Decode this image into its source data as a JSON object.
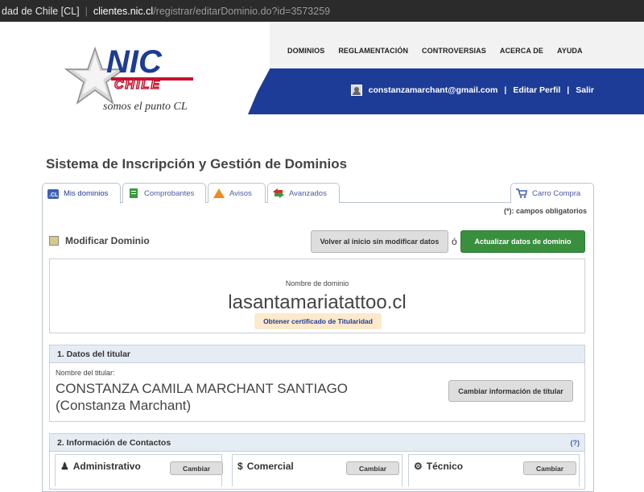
{
  "browser": {
    "tab_title": "dad de Chile [CL]",
    "url_host": "clientes.nic.cl",
    "url_path": "/registrar/editarDominio.do?id=3573259"
  },
  "logo": {
    "brand": "NIC",
    "sub": "CHILE",
    "tagline": "somos el punto CL"
  },
  "topnav": [
    "DOMINIOS",
    "REGLAMENTACIÓN",
    "CONTROVERSIAS",
    "ACERCA DE",
    "AYUDA"
  ],
  "user": {
    "email": "constanzamarchant@gmail.com",
    "edit_profile": "Editar Perfil",
    "logout": "Salir",
    "separator": "|"
  },
  "page_title": "Sistema de Inscripción y Gestión de Dominios",
  "tabs": [
    {
      "label": "Mis dominios",
      "icon": "domain-cl-icon"
    },
    {
      "label": "Comprobantes",
      "icon": "document-icon"
    },
    {
      "label": "Avisos",
      "icon": "warning-icon"
    },
    {
      "label": "Avanzados",
      "icon": "arrows-icon"
    },
    {
      "label": "Carro Compra",
      "icon": "cart-icon"
    }
  ],
  "required_note": "(*): campos obligatorios",
  "section": {
    "title": "Modificar Dominio",
    "back_button": "Volver al inicio sin modificar datos",
    "or": "ó",
    "update_button": "Actualizar datos de dominio"
  },
  "domain": {
    "label": "Nombre de dominio",
    "name": "lasantamariatattoo.cl",
    "certificate_button": "Obtener certificado de Titularidad"
  },
  "titular": {
    "header": "1. Datos del titular",
    "label": "Nombre del titular:",
    "name_line1": "CONSTANZA CAMILA MARCHANT SANTIAGO",
    "name_line2": "(Constanza Marchant)",
    "change_button": "Cambiar información de titular"
  },
  "contacts": {
    "header": "2. Información de Contactos",
    "help": "(?)",
    "items": [
      {
        "title": "Administrativo",
        "button": "Cambiar",
        "icon": "user-icon"
      },
      {
        "title": "Comercial",
        "button": "Cambiar",
        "icon": "dollar-icon"
      },
      {
        "title": "Técnico",
        "button": "Cambiar",
        "icon": "gear-icon"
      }
    ]
  },
  "colors": {
    "brand_blue": "#1d3c97",
    "action_green": "#3a8f3e",
    "panel_header": "#e6ecf3",
    "logo_red": "#c8102e"
  }
}
